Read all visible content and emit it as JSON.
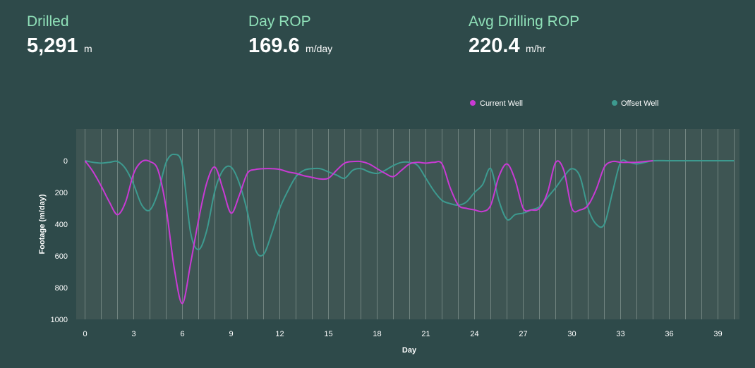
{
  "kpis": [
    {
      "label": "Drilled",
      "value": "5,291",
      "unit": "m"
    },
    {
      "label": "Day ROP",
      "value": "169.6",
      "unit": "m/day"
    },
    {
      "label": "Avg Drilling ROP",
      "value": "220.4",
      "unit": "m/hr"
    }
  ],
  "colors": {
    "background": "#2e4a4a",
    "plot_background": "#3e5553",
    "kpi_label": "#8fe0b8",
    "current_well": "#c93ad4",
    "offset_well": "#3d9a8f"
  },
  "chart_data": {
    "type": "line",
    "title": "",
    "xlabel": "Day",
    "ylabel": "Footage (m/day)",
    "xlim": [
      -1,
      40.5
    ],
    "ylim": [
      1000,
      -200
    ],
    "y_reversed": true,
    "x_ticks": [
      0,
      3,
      6,
      9,
      12,
      15,
      18,
      21,
      24,
      27,
      30,
      33,
      36,
      39
    ],
    "y_ticks": [
      0,
      200,
      400,
      600,
      800,
      1000
    ],
    "grid": "vertical lines every day",
    "legend_position": "top-right",
    "series": [
      {
        "name": "Current Well",
        "color": "#c93ad4",
        "x": [
          0,
          0.5,
          1,
          1.5,
          2,
          2.5,
          3,
          3.5,
          4,
          4.5,
          5,
          5.5,
          6,
          6.5,
          7,
          7.5,
          8,
          8.5,
          9,
          9.5,
          10,
          10.5,
          11,
          11.5,
          12,
          12.5,
          13,
          13.5,
          14,
          14.5,
          15,
          15.5,
          16,
          16.5,
          17,
          17.5,
          18,
          18.5,
          19,
          19.5,
          20,
          20.5,
          21,
          21.5,
          22,
          22.5,
          23,
          23.5,
          24,
          24.5,
          25,
          25.5,
          26,
          26.5,
          27,
          27.5,
          28,
          28.5,
          29,
          29.5,
          30,
          30.5,
          31,
          31.5,
          32,
          32.5,
          33,
          33.5,
          34,
          34.5,
          35
        ],
        "y": [
          0,
          70,
          160,
          260,
          340,
          260,
          80,
          5,
          5,
          60,
          300,
          680,
          900,
          650,
          370,
          140,
          40,
          180,
          330,
          220,
          80,
          55,
          50,
          50,
          55,
          70,
          80,
          95,
          105,
          115,
          110,
          60,
          15,
          5,
          5,
          20,
          50,
          80,
          100,
          60,
          20,
          10,
          15,
          10,
          20,
          170,
          280,
          300,
          310,
          320,
          280,
          100,
          20,
          120,
          300,
          310,
          300,
          200,
          10,
          60,
          300,
          310,
          280,
          180,
          40,
          5,
          10,
          10,
          10,
          5,
          0
        ]
      },
      {
        "name": "Offset Well",
        "color": "#3d9a8f",
        "x": [
          0,
          0.5,
          1,
          1.5,
          2,
          2.5,
          3,
          3.5,
          4,
          4.5,
          5,
          5.5,
          6,
          6.5,
          7,
          7.5,
          8,
          8.5,
          9,
          9.5,
          10,
          10.5,
          11,
          11.5,
          12,
          12.5,
          13,
          13.5,
          14,
          14.5,
          15,
          15.5,
          16,
          16.5,
          17,
          17.5,
          18,
          18.5,
          19,
          19.5,
          20,
          20.5,
          21,
          21.5,
          22,
          22.5,
          23,
          23.5,
          24,
          24.5,
          25,
          25.5,
          26,
          26.5,
          27,
          27.5,
          28,
          28.5,
          29,
          29.5,
          30,
          30.5,
          31,
          31.5,
          32,
          32.5,
          33,
          33.5,
          34,
          34.5,
          35,
          36,
          37,
          38,
          39,
          40
        ],
        "y": [
          0,
          10,
          15,
          10,
          5,
          50,
          150,
          280,
          310,
          200,
          10,
          -40,
          30,
          450,
          560,
          440,
          190,
          60,
          40,
          140,
          320,
          560,
          590,
          460,
          300,
          190,
          100,
          60,
          50,
          50,
          70,
          90,
          110,
          60,
          50,
          70,
          80,
          60,
          30,
          10,
          10,
          30,
          110,
          190,
          250,
          270,
          280,
          260,
          200,
          150,
          50,
          250,
          370,
          340,
          330,
          310,
          290,
          230,
          170,
          100,
          50,
          100,
          300,
          400,
          400,
          200,
          10,
          10,
          20,
          10,
          0,
          0,
          0,
          0,
          0,
          0
        ]
      }
    ]
  }
}
